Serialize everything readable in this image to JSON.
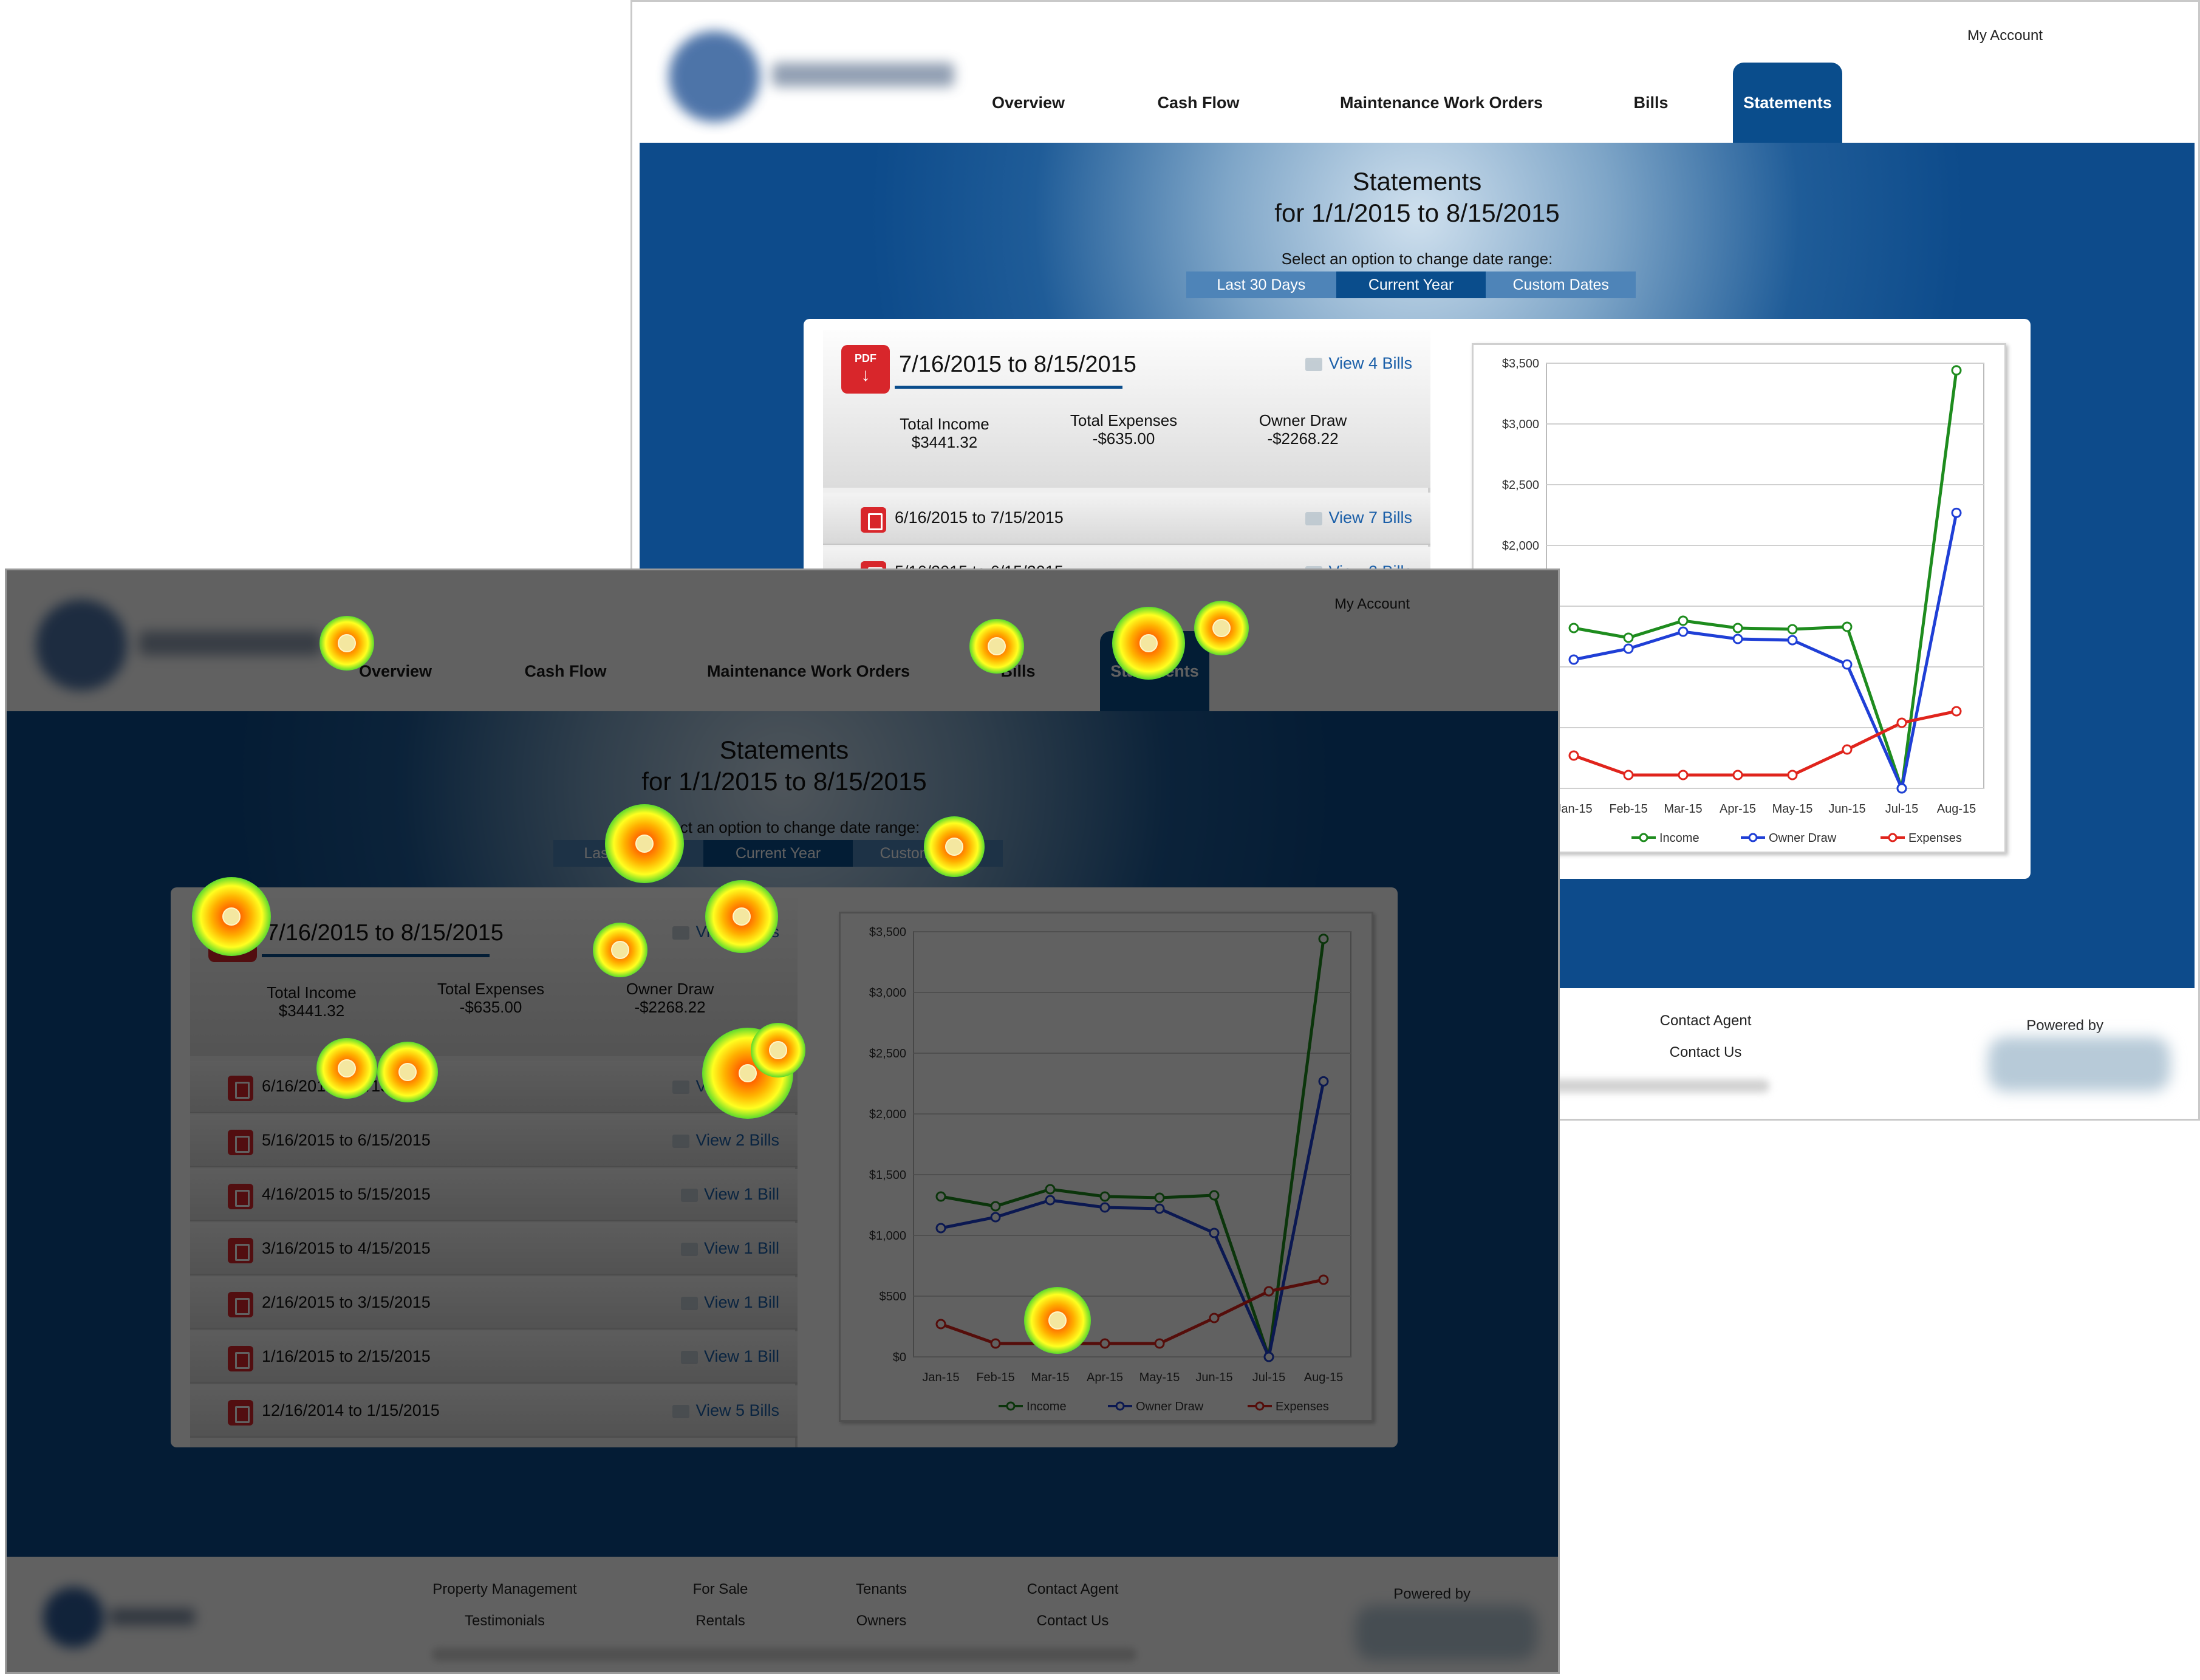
{
  "header": {
    "my_account": "My Account",
    "nav": [
      "Overview",
      "Cash Flow",
      "Maintenance Work Orders",
      "Bills",
      "Statements"
    ],
    "active_nav": "Statements"
  },
  "statements": {
    "title_line1": "Statements",
    "title_line2": "for 1/1/2015 to 8/15/2015",
    "select_label": "Select an option to change date range:",
    "range_options": [
      "Last 30 Days",
      "Current Year",
      "Custom Dates"
    ],
    "active_range": "Current Year",
    "current": {
      "range": "7/16/2015 to 8/15/2015",
      "view_link": "View 4 Bills",
      "pdf_label": "PDF",
      "summary": [
        {
          "label": "Total Income",
          "value": "$3441.32"
        },
        {
          "label": "Total Expenses",
          "value": "-$635.00"
        },
        {
          "label": "Owner Draw",
          "value": "-$2268.22"
        }
      ]
    },
    "rows": [
      {
        "range": "6/16/2015 to 7/15/2015",
        "view_link": "View 7 Bills"
      },
      {
        "range": "5/16/2015 to 6/15/2015",
        "view_link": "View 2 Bills"
      },
      {
        "range": "4/16/2015 to 5/15/2015",
        "view_link": "View 1 Bill"
      },
      {
        "range": "3/16/2015 to 4/15/2015",
        "view_link": "View 1 Bill"
      },
      {
        "range": "2/16/2015 to 3/15/2015",
        "view_link": "View 1 Bill"
      },
      {
        "range": "1/16/2015 to 2/15/2015",
        "view_link": "View 1 Bill"
      },
      {
        "range": "12/16/2014 to 1/15/2015",
        "view_link": "View 5 Bills"
      }
    ]
  },
  "footer": {
    "links": [
      "Property Management",
      "Testimonials",
      "For Sale",
      "Rentals",
      "Tenants",
      "Owners",
      "Contact Agent",
      "Contact Us"
    ],
    "powered_by": "Powered by"
  },
  "colors": {
    "brand_blue": "#0a4d8c",
    "income": "#1e8c1e",
    "owner_draw": "#1f3fd6",
    "expenses": "#e0241c",
    "pdf_red": "#d8262b"
  },
  "chart_data": {
    "type": "line",
    "categories": [
      "Jan-15",
      "Feb-15",
      "Mar-15",
      "Apr-15",
      "May-15",
      "Jun-15",
      "Jul-15",
      "Aug-15"
    ],
    "series": [
      {
        "name": "Income",
        "values": [
          1320,
          1240,
          1380,
          1320,
          1310,
          1330,
          0,
          3441.32
        ]
      },
      {
        "name": "Owner Draw",
        "values": [
          1060,
          1150,
          1290,
          1230,
          1220,
          1020,
          0,
          2268.22
        ]
      },
      {
        "name": "Expenses",
        "values": [
          270,
          110,
          110,
          110,
          110,
          320,
          540,
          635
        ]
      }
    ],
    "y_ticks": [
      "$0",
      "$500",
      "$1,000",
      "$1,500",
      "$2,000",
      "$2,500",
      "$3,000",
      "$3,500"
    ],
    "ylim": [
      0,
      3500
    ],
    "grid": true,
    "legend": "bottom"
  }
}
